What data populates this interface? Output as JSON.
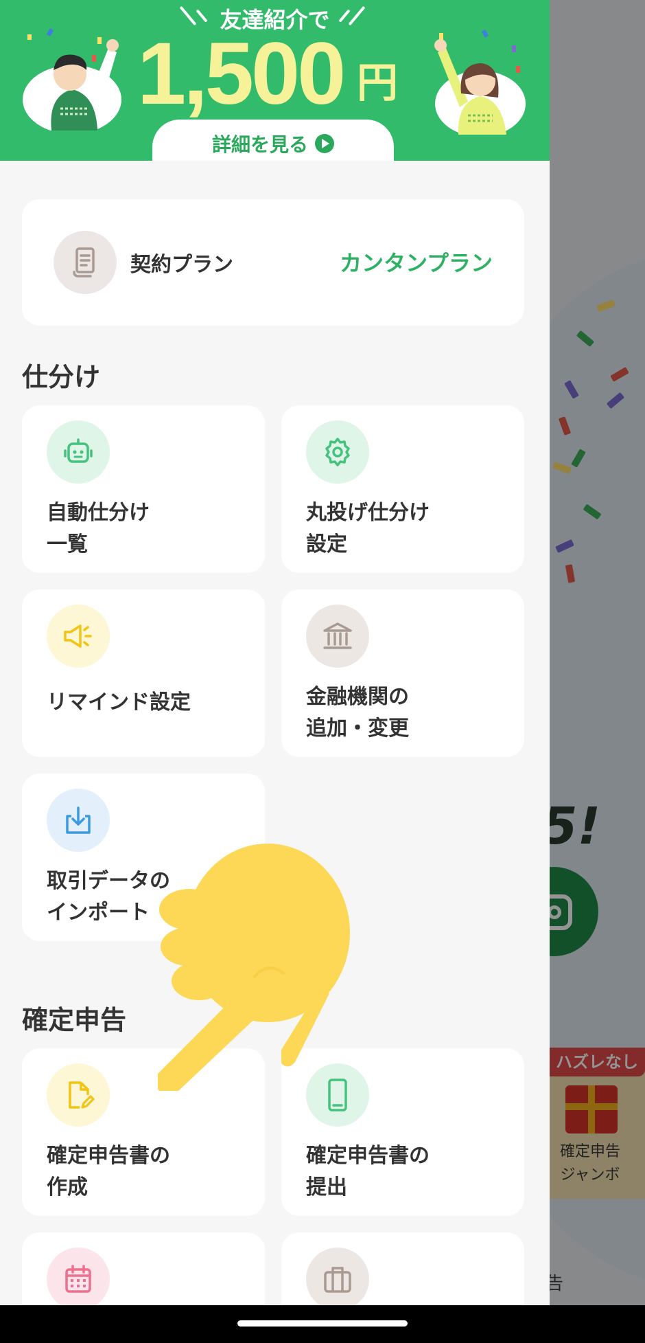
{
  "banner": {
    "headline": "友達紹介で",
    "amount": "1,500",
    "currency": "円",
    "detail_label": "詳細を見る",
    "bg_color": "#33bb6c",
    "amount_color": "#f6f29a"
  },
  "plan": {
    "label": "契約プラン",
    "value": "カンタンプラン",
    "icon": "receipt-icon"
  },
  "sections": {
    "shiwake": {
      "title": "仕分け",
      "tiles": [
        {
          "label": "自動仕分け\n一覧",
          "icon": "robot-icon"
        },
        {
          "label": "丸投げ仕分け\n設定",
          "icon": "gear-icon"
        },
        {
          "label": "リマインド設定",
          "icon": "megaphone-icon"
        },
        {
          "label": "金融機関の\n追加・変更",
          "icon": "bank-icon"
        },
        {
          "label": "取引データの\nインポート",
          "icon": "import-icon"
        }
      ]
    },
    "kakutei": {
      "title": "確定申告",
      "tiles": [
        {
          "label": "確定申告書の\n作成",
          "icon": "document-edit-icon"
        },
        {
          "label": "確定申告書の\n提出",
          "icon": "smartphone-icon"
        },
        {
          "label": "",
          "icon": "calendar-icon"
        },
        {
          "label": "",
          "icon": "briefcase-icon"
        }
      ]
    }
  },
  "background_app": {
    "jumbo_tag": "ハズレなし",
    "jumbo_title": "確定申告\nジャンボ",
    "shout": "5!",
    "bottom_char": "告"
  },
  "colors": {
    "accent_green": "#2fb163",
    "icon_green": "#46c27f",
    "icon_yellow": "#f2c414",
    "icon_brown": "#a99a92",
    "icon_blue": "#3c9be0",
    "icon_pink": "#ee6f8f"
  }
}
